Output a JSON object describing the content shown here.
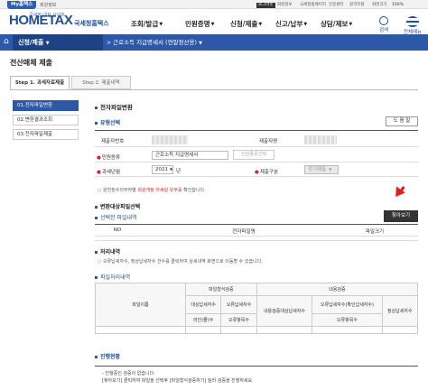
{
  "topbar": {
    "my_badge": "My홈택스",
    "login": "회원정보",
    "links": [
      "로그아웃",
      "회원정보",
      "국세청홈페이지",
      "인증센터",
      "원격지원",
      "화면크기"
    ],
    "zoom": "100%"
  },
  "logo": {
    "sub": "국세청 대표 사이트",
    "home": "HOMETAX",
    "name": "국세청홈택스"
  },
  "gnb": [
    "조회/발급",
    "민원증명",
    "신청/제출",
    "신고/납부",
    "상담/제보"
  ],
  "icons": {
    "search": "검색",
    "menu": "전체메뉴"
  },
  "nav": {
    "current": "신청/제출",
    "sub": "근로소득 지급명세서 (연말정산용)"
  },
  "page_title": "전산매체 제출",
  "tabs": [
    "Step 1. 과세자료제출",
    "Step 2. 제출내역"
  ],
  "side": [
    "01.전자파일변환",
    "02.변환결과조회",
    "03.전자파일제출"
  ],
  "section1": {
    "title": "전자파일변환",
    "subtitle": "유형선택",
    "help_btn": "도 움 말",
    "submitter_no_label": "제출자번호",
    "submitter_name_label": "제출자명",
    "civil_type_label": "민원종류",
    "civil_type_value": "근로소득 지급명세서",
    "civil_select_btn": "민원종류선택",
    "year_label": "과세년월",
    "year_value": "2021",
    "year_unit": "년",
    "submit_type_label": "제출구분",
    "submit_type_value": "정기제출"
  },
  "notice": {
    "prefix": "원천징수의무자별 ",
    "red": "회원개정 차세원 유무",
    "suffix": "를 확인합니다."
  },
  "section2": {
    "title": "변환대상파일선택",
    "subtitle": "선택한 파일내역",
    "download_btn": "찾아보기",
    "columns": [
      "NO",
      "전자파일명",
      "파일크기"
    ]
  },
  "section3": {
    "title": "처리내역",
    "desc": "오류납세자수, 정상납세자수 건수를 클릭하여 상세내역 화면으로 이동할 수 있습니다.",
    "subtitle": "파일처리내역",
    "headers": {
      "file_name": "파일이름",
      "format_check": "파일형식검증",
      "content_check": "내용검증",
      "target_taxpayers": "대상납세자수",
      "normal_taxpayers": "오류납세자수",
      "line_count": "라인(줄)수",
      "normal_count": "오류항목수",
      "content_target": "내용검증대상납세자수",
      "content_error": "오류납세자수(확인납세자수)",
      "content_error_items": "오류항목수",
      "content_normal": "정상납세자수"
    }
  },
  "section4": {
    "title": "진행현황",
    "line1": "- 진행중인 검증이 없습니다.",
    "line2": "[찾아보기] 클릭하여 파일을 선택후 [파일형식검증하기] 눌러 검증을 진행하세요."
  }
}
